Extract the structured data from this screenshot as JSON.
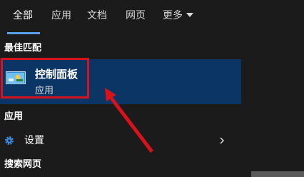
{
  "tabs": [
    {
      "label": "全部",
      "active": true
    },
    {
      "label": "应用"
    },
    {
      "label": "文档"
    },
    {
      "label": "网页"
    },
    {
      "label": "更多"
    }
  ],
  "sections": {
    "best_match": "最佳匹配",
    "apps": "应用",
    "search_web": "搜索网页"
  },
  "best_match_item": {
    "title": "控制面板",
    "subtitle": "应用",
    "icon": "control-panel-icon"
  },
  "app_items": [
    {
      "label": "设置",
      "icon": "gear-icon"
    }
  ],
  "colors": {
    "background": "#1b1b1b",
    "selected": "#0b3565",
    "accent": "#5aa0e6",
    "annotation": "#d7121b"
  }
}
